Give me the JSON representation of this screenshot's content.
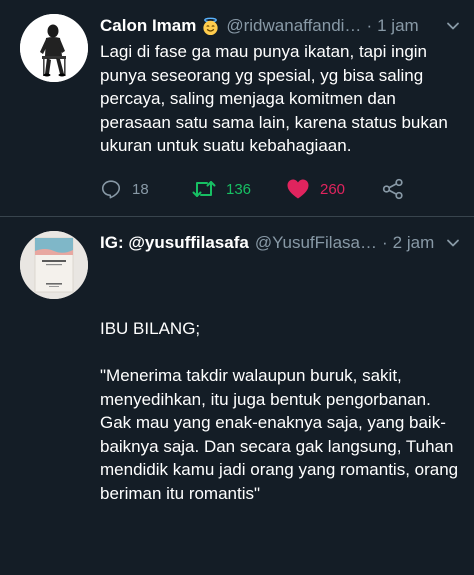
{
  "tweets": [
    {
      "display_name": "Calon Imam",
      "badge_icon": "smiling-face-with-halo-emoji",
      "handle": "@ridwanaffandi…",
      "separator": "·",
      "time": "1 jam",
      "text": "Lagi di fase ga mau punya ikatan, tapi ingin punya seseorang yg spesial, yg bisa saling percaya, saling menjaga komitmen dan perasaan satu sama lain, karena status bukan ukuran untuk suatu kebahagiaan.",
      "replies": "18",
      "retweets": "136",
      "likes": "260",
      "retweet_color": "#17bf63",
      "like_color": "#e0245e"
    },
    {
      "display_name": "IG: @yusuffilasafa",
      "handle": "@YusufFilasa…",
      "separator": "·",
      "time": "2 jam",
      "text": "IBU BILANG;\n\n\"Menerima takdir walaupun buruk, sakit, menyedihkan, itu juga bentuk pengorbanan. Gak mau yang enak-enaknya saja, yang baik-baiknya saja. Dan secara gak langsung, Tuhan mendidik kamu jadi orang yang romantis, orang beriman itu romantis\"",
      "avatar_book": {
        "title": "IBUKU BILANG",
        "author": "Yusuf Filasafa"
      }
    }
  ],
  "theme": {
    "background": "#141d26",
    "secondary_text": "#8899a6",
    "divider": "#38444d"
  }
}
